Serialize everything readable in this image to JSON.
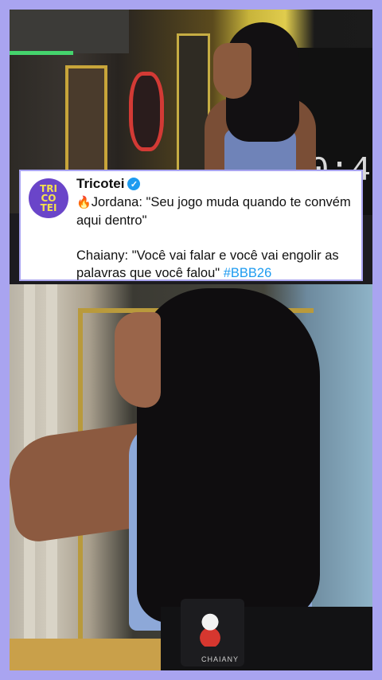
{
  "tweet": {
    "author": "Tricotei",
    "avatar_text": [
      "TRI",
      "CO",
      "TEI"
    ],
    "line1_emoji": "🔥",
    "line1_text": "Jordana: \"Seu jogo muda quando te convém aqui dentro\"",
    "line2_text": "Chaiany: \"Você vai falar e você vai engolir as palavras que você falou\"",
    "hashtag": "#BBB26"
  },
  "video_top": {
    "clock_text": "0:4"
  },
  "video_bottom": {
    "mic_label": "CHAIANY"
  },
  "colors": {
    "page_border": "#a9a4f0",
    "avatar_bg": "#6a45c9",
    "avatar_text": "#f4e04d",
    "verified": "#1d9bf0",
    "hashtag": "#1d9bf0"
  }
}
